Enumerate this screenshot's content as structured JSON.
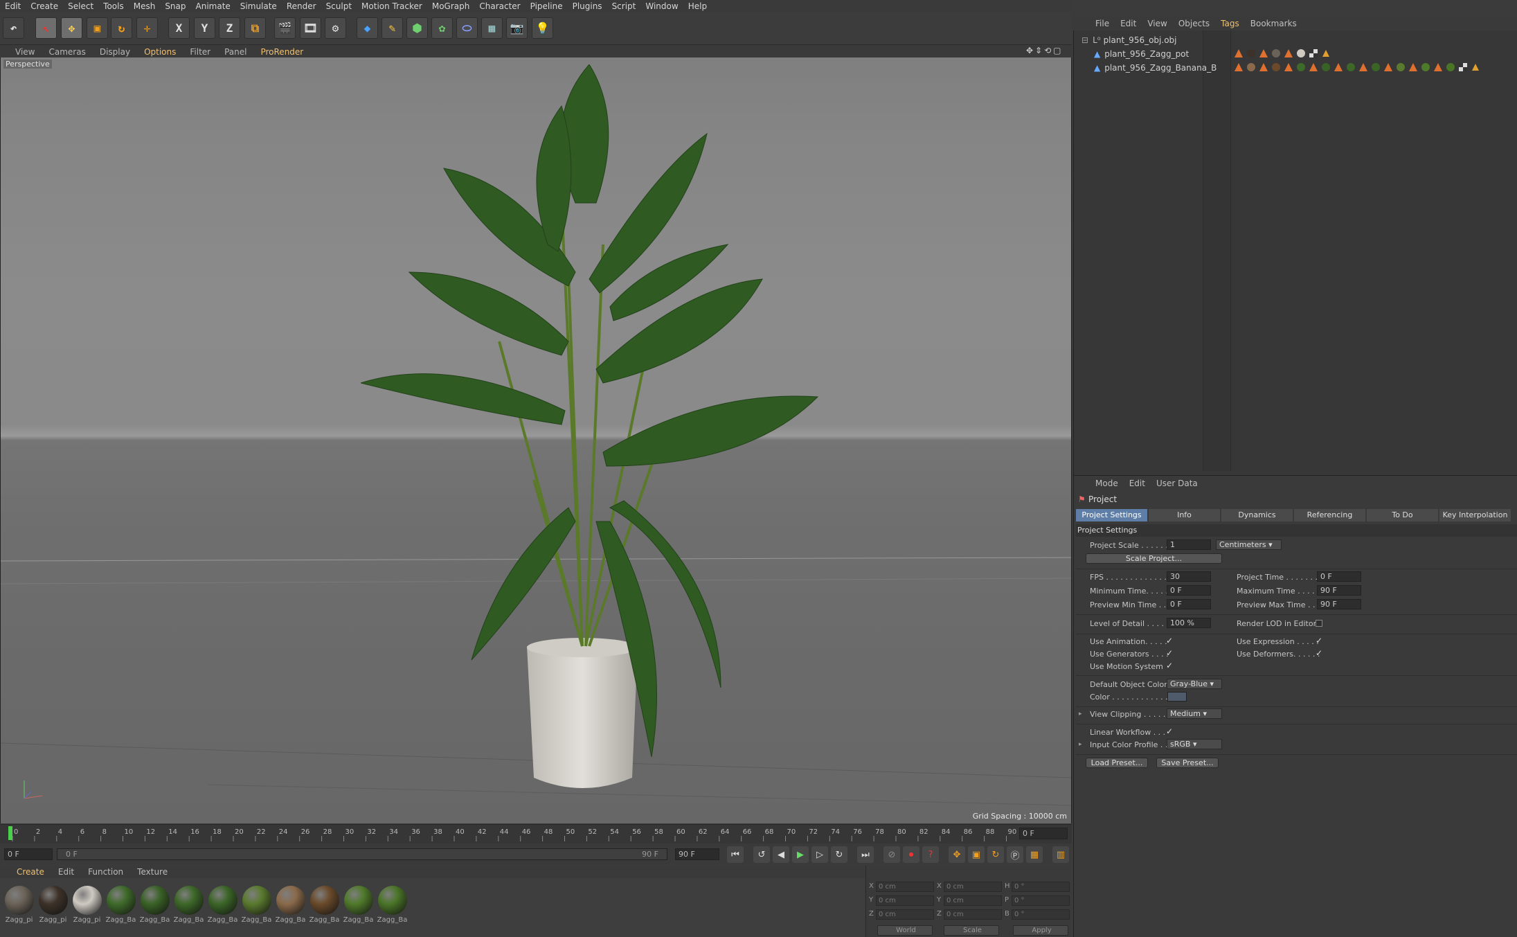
{
  "menu": {
    "items": [
      "Edit",
      "Create",
      "Select",
      "Tools",
      "Mesh",
      "Snap",
      "Animate",
      "Simulate",
      "Render",
      "Sculpt",
      "Motion Tracker",
      "MoGraph",
      "Character",
      "Pipeline",
      "Plugins",
      "Script",
      "Window",
      "Help"
    ]
  },
  "toolbar": {
    "x_label": "X",
    "y_label": "Y",
    "z_label": "Z"
  },
  "viewport": {
    "menu": [
      "View",
      "Cameras",
      "Display",
      "Options",
      "Filter",
      "Panel",
      "ProRender"
    ],
    "label": "Perspective",
    "grid_spacing": "Grid Spacing : 10000 cm"
  },
  "timeline": {
    "ticks": [
      "0",
      "2",
      "4",
      "6",
      "8",
      "10",
      "12",
      "14",
      "16",
      "18",
      "20",
      "22",
      "24",
      "26",
      "28",
      "30",
      "32",
      "34",
      "36",
      "38",
      "40",
      "42",
      "44",
      "46",
      "48",
      "50",
      "52",
      "54",
      "56",
      "58",
      "60",
      "62",
      "64",
      "66",
      "68",
      "70",
      "72",
      "74",
      "76",
      "78",
      "80",
      "82",
      "84",
      "86",
      "88",
      "90"
    ],
    "current_frame": "0 F",
    "start": "0 F",
    "range_start": "0 F",
    "range_end": "90 F",
    "end": "90 F"
  },
  "material_manager": {
    "menu": [
      "Create",
      "Edit",
      "Function",
      "Texture"
    ],
    "materials": [
      {
        "name": "Zagg_pi",
        "color": "#6b6358"
      },
      {
        "name": "Zagg_pi",
        "color": "#3d3229"
      },
      {
        "name": "Zagg_pi",
        "color": "#cfcac2"
      },
      {
        "name": "Zagg_Ba",
        "color": "#3f6b2a"
      },
      {
        "name": "Zagg_Ba",
        "color": "#3a6226"
      },
      {
        "name": "Zagg_Ba",
        "color": "#3d6828"
      },
      {
        "name": "Zagg_Ba",
        "color": "#3b6527"
      },
      {
        "name": "Zagg_Ba",
        "color": "#5a7a2e"
      },
      {
        "name": "Zagg_Ba",
        "color": "#8a6a4a"
      },
      {
        "name": "Zagg_Ba",
        "color": "#6a4a2a"
      },
      {
        "name": "Zagg_Ba",
        "color": "#4f7a2a"
      },
      {
        "name": "Zagg_Ba",
        "color": "#4a7527"
      }
    ]
  },
  "coordinates": {
    "rows": [
      {
        "a": "X",
        "av": "0 cm",
        "b": "X",
        "bv": "0 cm",
        "c": "H",
        "cv": "0 °"
      },
      {
        "a": "Y",
        "av": "0 cm",
        "b": "Y",
        "bv": "0 cm",
        "c": "P",
        "cv": "0 °"
      },
      {
        "a": "Z",
        "av": "0 cm",
        "b": "Z",
        "bv": "0 cm",
        "c": "B",
        "cv": "0 °"
      }
    ],
    "mode": "World",
    "scale": "Scale",
    "apply": "Apply"
  },
  "object_manager": {
    "menu": [
      "File",
      "Edit",
      "View",
      "Objects",
      "Tags",
      "Bookmarks"
    ],
    "objects": [
      {
        "name": "plant_956_obj.obj"
      },
      {
        "name": "plant_956_Zagg_pot"
      },
      {
        "name": "plant_956_Zagg_Banana_B"
      }
    ]
  },
  "attributes": {
    "menu": [
      "Mode",
      "Edit",
      "User Data"
    ],
    "title": "Project",
    "tabs": [
      "Project Settings",
      "Info",
      "Dynamics",
      "Referencing",
      "To Do",
      "Key Interpolation"
    ],
    "section": "Project Settings",
    "project_scale_label": "Project Scale . . . . . .",
    "project_scale": "1",
    "project_scale_unit": "Centimeters",
    "scale_project_btn": "Scale Project...",
    "fps_label": "FPS . . . . . . . . . . . . . .",
    "fps": "30",
    "project_time_label": "Project Time . . . . . . .",
    "project_time": "0 F",
    "min_time_label": "Minimum Time. . . . . .",
    "min_time": "0 F",
    "max_time_label": "Maximum Time . . . . .",
    "max_time": "90 F",
    "preview_min_label": "Preview Min Time . .",
    "preview_min": "0 F",
    "preview_max_label": "Preview Max Time . . .",
    "preview_max": "90 F",
    "lod_label": "Level of Detail . . . . .",
    "lod": "100 %",
    "render_lod_label": "Render LOD in Editor",
    "use_animation_label": "Use Animation. . . . .",
    "use_expression_label": "Use Expression . . . . .",
    "use_generators_label": "Use Generators . . . .",
    "use_deformers_label": "Use Deformers. . . . . .",
    "use_motion_label": "Use Motion System",
    "default_color_label": "Default Object Color",
    "default_color": "Gray-Blue",
    "color_label": "Color . . . . . . . . . . . .",
    "view_clipping_label": "View Clipping . . . . .",
    "view_clipping": "Medium",
    "linear_workflow_label": "Linear Workflow . . .",
    "input_profile_label": "Input Color Profile . .",
    "input_profile": "sRGB",
    "load_preset": "Load Preset...",
    "save_preset": "Save Preset...",
    "check": "✓"
  },
  "colors": {
    "accent": "#f0c070",
    "tab_active": "#5e7ea8"
  }
}
